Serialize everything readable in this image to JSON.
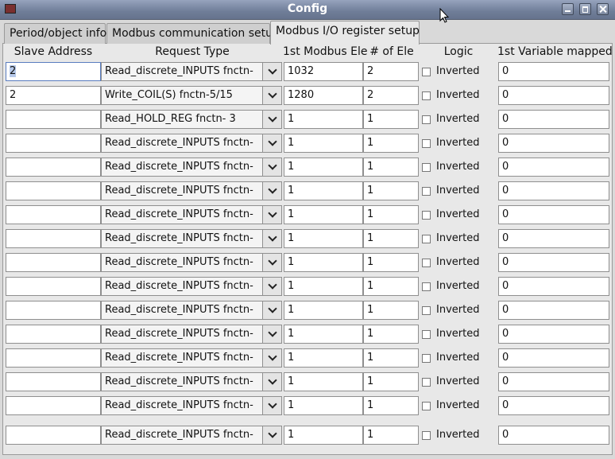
{
  "window": {
    "title": "Config"
  },
  "tabs": [
    {
      "label": "Period/object info"
    },
    {
      "label": "Modbus communication setup"
    },
    {
      "label": "Modbus  I/O register setup"
    }
  ],
  "headers": {
    "slave": "Slave Address",
    "request": "Request Type",
    "first_ele": "1st Modbus Ele",
    "num_ele": "# of Ele",
    "logic": "Logic",
    "first_var": "1st Variable mapped"
  },
  "rows": [
    {
      "slave": "2",
      "request": "Read_discrete_INPUTS  fnctn-",
      "first_ele": "1032",
      "num_ele": "2",
      "logic": "Inverted",
      "first_var": "0"
    },
    {
      "slave": "2",
      "request": "Write_COIL(S)          fnctn-5/15",
      "first_ele": "1280",
      "num_ele": "2",
      "logic": "Inverted",
      "first_var": "0"
    },
    {
      "slave": "",
      "request": "Read_HOLD_REG        fnctn- 3",
      "first_ele": "1",
      "num_ele": "1",
      "logic": "Inverted",
      "first_var": "0"
    },
    {
      "slave": "",
      "request": "Read_discrete_INPUTS  fnctn-",
      "first_ele": "1",
      "num_ele": "1",
      "logic": "Inverted",
      "first_var": "0"
    },
    {
      "slave": "",
      "request": "Read_discrete_INPUTS  fnctn-",
      "first_ele": "1",
      "num_ele": "1",
      "logic": "Inverted",
      "first_var": "0"
    },
    {
      "slave": "",
      "request": "Read_discrete_INPUTS  fnctn-",
      "first_ele": "1",
      "num_ele": "1",
      "logic": "Inverted",
      "first_var": "0"
    },
    {
      "slave": "",
      "request": "Read_discrete_INPUTS  fnctn-",
      "first_ele": "1",
      "num_ele": "1",
      "logic": "Inverted",
      "first_var": "0"
    },
    {
      "slave": "",
      "request": "Read_discrete_INPUTS  fnctn-",
      "first_ele": "1",
      "num_ele": "1",
      "logic": "Inverted",
      "first_var": "0"
    },
    {
      "slave": "",
      "request": "Read_discrete_INPUTS  fnctn-",
      "first_ele": "1",
      "num_ele": "1",
      "logic": "Inverted",
      "first_var": "0"
    },
    {
      "slave": "",
      "request": "Read_discrete_INPUTS  fnctn-",
      "first_ele": "1",
      "num_ele": "1",
      "logic": "Inverted",
      "first_var": "0"
    },
    {
      "slave": "",
      "request": "Read_discrete_INPUTS  fnctn-",
      "first_ele": "1",
      "num_ele": "1",
      "logic": "Inverted",
      "first_var": "0"
    },
    {
      "slave": "",
      "request": "Read_discrete_INPUTS  fnctn-",
      "first_ele": "1",
      "num_ele": "1",
      "logic": "Inverted",
      "first_var": "0"
    },
    {
      "slave": "",
      "request": "Read_discrete_INPUTS  fnctn-",
      "first_ele": "1",
      "num_ele": "1",
      "logic": "Inverted",
      "first_var": "0"
    },
    {
      "slave": "",
      "request": "Read_discrete_INPUTS  fnctn-",
      "first_ele": "1",
      "num_ele": "1",
      "logic": "Inverted",
      "first_var": "0"
    },
    {
      "slave": "",
      "request": "Read_discrete_INPUTS  fnctn-",
      "first_ele": "1",
      "num_ele": "1",
      "logic": "Inverted",
      "first_var": "0"
    },
    {
      "slave": "",
      "request": "Read_discrete_INPUTS  fnctn-",
      "first_ele": "1",
      "num_ele": "1",
      "logic": "Inverted",
      "first_var": "0"
    }
  ]
}
